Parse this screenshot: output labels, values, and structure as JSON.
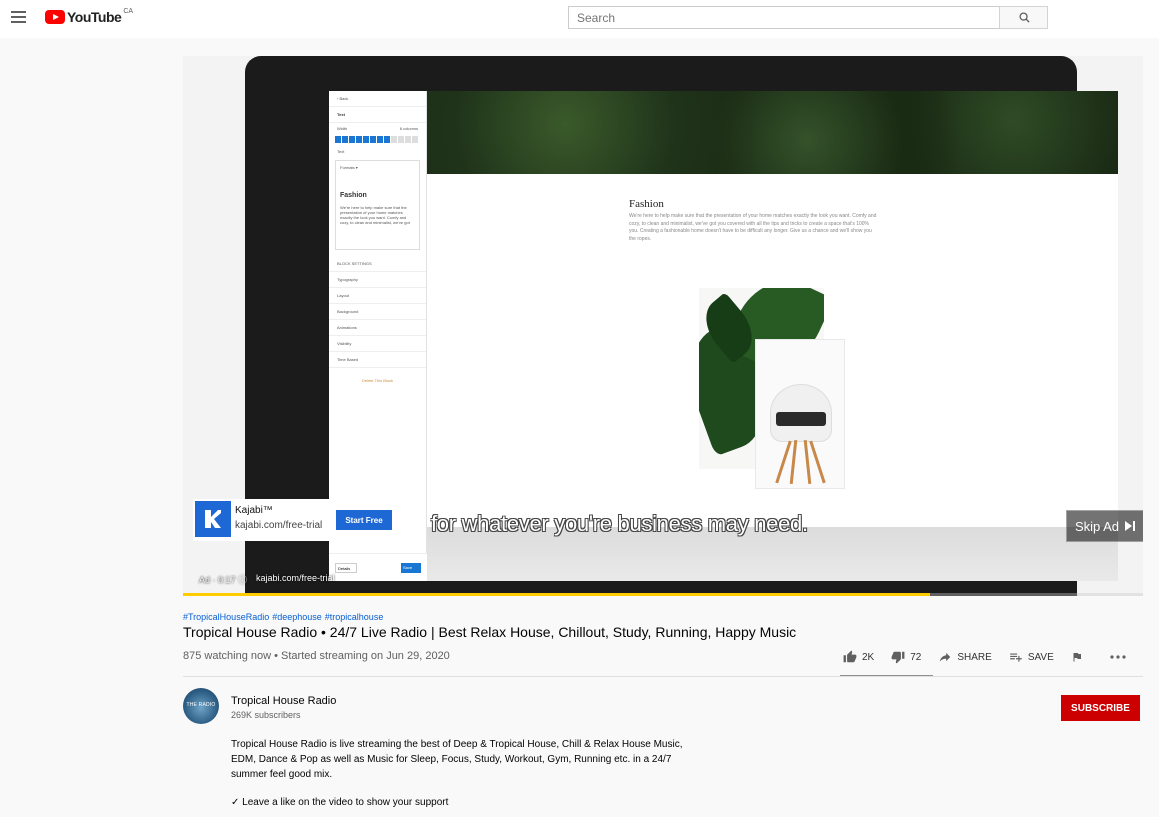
{
  "masthead": {
    "logo_text": "YouTube",
    "country": "CA",
    "search_placeholder": "Search",
    "menu_icon": "hamburger-icon",
    "search_icon": "search-icon"
  },
  "player": {
    "editor": {
      "back_label": "‹ Back",
      "section_title": "Text",
      "width_label": "Width",
      "columns_label": "8 columns",
      "text_label": "Text",
      "format_label": "Formats ▾",
      "doc_heading": "Fashion",
      "doc_body": "We're here to help make sure that the presentation of your home matches exactly the look you want. Comfy and cozy, to clean and minimalist, we've got",
      "block_settings": "BLOCK SETTINGS",
      "settings": [
        "Typography",
        "Layout",
        "Background",
        "Animations",
        "Visibility",
        "Time Based"
      ],
      "delete_label": "Delete This Block",
      "details_label": "Details",
      "save_label": "Save",
      "width_filled": 8,
      "width_total": 12
    },
    "content": {
      "heading": "Fashion",
      "body": "We're here to help make sure that the presentation of your home matches exactly the look you want. Comfy and cozy, to clean and minimalist, we've got you covered with all the tips and tricks to create a space that's 100% you. Creating a fashionable home doesn't have to be difficult any longer. Give us a chance and we'll show you the ropes."
    },
    "caption": "for whatever you're business may need.",
    "ad": {
      "advertiser": "Kajabi™",
      "url": "kajabi.com/free-trial",
      "cta": "Start Free",
      "skip_label": "Skip Ad",
      "ad_label": "Ad · 0:17 ⓘ",
      "footer_url": "kajabi.com/free-trial"
    },
    "progress": 0.778,
    "colors": {
      "progress": "#ffcc00",
      "ad_blue": "#1e68d6"
    }
  },
  "video": {
    "hashtags": [
      "#TropicalHouseRadio",
      "#deephouse",
      "#tropicalhouse"
    ],
    "title": "Tropical House Radio • 24/7 Live Radio | Best Relax House, Chillout, Study, Running, Happy Music",
    "meta": "875 watching now • Started streaming on Jun 29, 2020",
    "likes": "2K",
    "dislikes": "72",
    "share_label": "SHARE",
    "save_label": "SAVE"
  },
  "channel": {
    "name": "Tropical House Radio",
    "subscribers": "269K subscribers",
    "avatar_text": "THE RADIO",
    "subscribe_label": "SUBSCRIBE",
    "description": "Tropical House Radio is live streaming the best of Deep & Tropical House, Chill & Relax House Music, EDM, Dance & Pop as well as Music for Sleep, Focus, Study, Workout, Gym, Running etc. in a 24/7 summer feel good mix.",
    "description_line2": "✓ Leave a like on the video to show your support",
    "colors": {
      "subscribe": "#cc0000"
    }
  }
}
